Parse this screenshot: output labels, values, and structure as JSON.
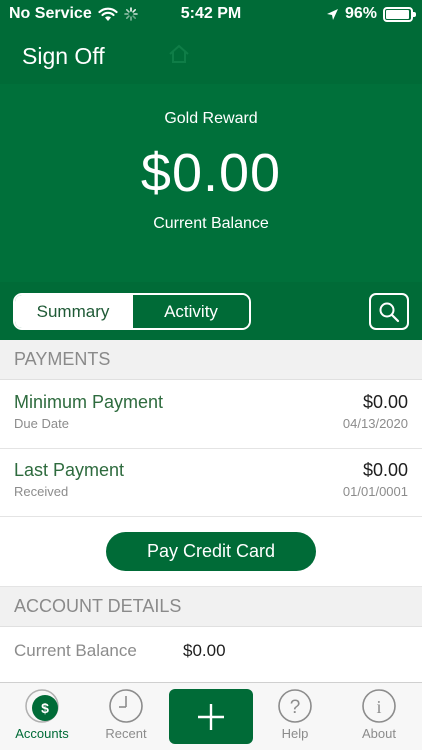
{
  "status_bar": {
    "carrier": "No Service",
    "time": "5:42 PM",
    "battery": "96%",
    "battery_level": 0.96
  },
  "nav": {
    "sign_off_label": "Sign Off"
  },
  "balance_panel": {
    "card_name": "Gold Reward",
    "amount": "$0.00",
    "label": "Current Balance"
  },
  "tabs": [
    {
      "label": "Summary",
      "active": true
    },
    {
      "label": "Activity",
      "active": false
    }
  ],
  "payments": {
    "header": "PAYMENTS",
    "items": [
      {
        "title": "Minimum Payment",
        "sub_label": "Due Date",
        "amount": "$0.00",
        "date": "04/13/2020"
      },
      {
        "title": "Last Payment",
        "sub_label": "Received",
        "amount": "$0.00",
        "date": "01/01/0001"
      }
    ],
    "pay_button_label": "Pay Credit Card"
  },
  "account_details": {
    "header": "ACCOUNT DETAILS",
    "current_balance_label": "Current Balance",
    "current_balance_value": "$0.00"
  },
  "tab_bar": {
    "items": [
      {
        "label": "Accounts",
        "icon": "dollar-icon",
        "selected": true
      },
      {
        "label": "Recent",
        "icon": "clock-icon",
        "selected": false
      },
      {
        "label": "",
        "icon": "plus-icon",
        "selected": false
      },
      {
        "label": "Help",
        "icon": "question-icon",
        "selected": false
      },
      {
        "label": "About",
        "icon": "info-icon",
        "selected": false
      }
    ]
  },
  "colors": {
    "brand_green": "#006b37",
    "text_green": "#2e6b3e",
    "muted": "#8c8c8c"
  }
}
